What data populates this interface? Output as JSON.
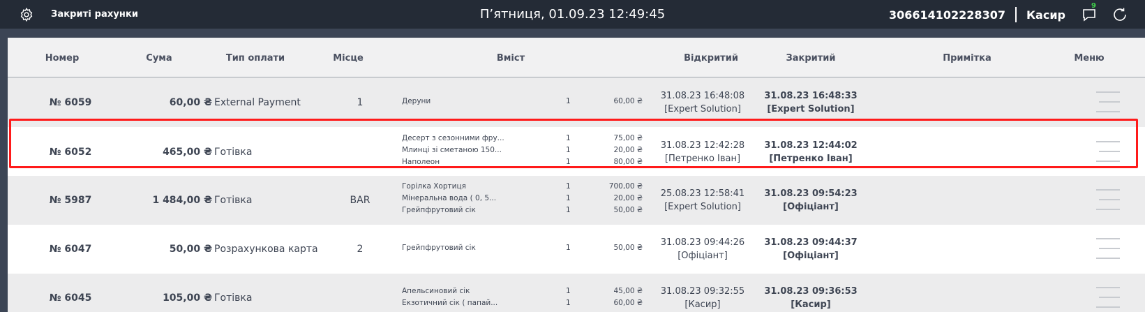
{
  "topbar": {
    "title": "Закриті рахунки",
    "datetime": "П’ятниця, 01.09.23 12:49:45",
    "code": "306614102228307",
    "role": "Касир",
    "chat_badge": "9"
  },
  "table": {
    "headers": {
      "number": "Номер",
      "sum": "Сума",
      "payment": "Тип оплати",
      "place": "Місце",
      "content": "Вміст",
      "opened": "Відкритий",
      "closed": "Закритий",
      "note": "Примітка",
      "menu": "Меню"
    },
    "rows": [
      {
        "number": "№ 6059",
        "sum": "60,00 ₴",
        "payment": "External Payment",
        "place": "1",
        "items": [
          {
            "name": "Деруни",
            "qty": "1",
            "price": "60,00 ₴"
          }
        ],
        "opened_time": "31.08.23 16:48:08",
        "opened_by": "[Expert Solution]",
        "closed_time": "31.08.23 16:48:33",
        "closed_by": "[Expert Solution]"
      },
      {
        "number": "№ 6052",
        "sum": "465,00 ₴",
        "payment": "Готівка",
        "place": "",
        "items": [
          {
            "name": "Десерт з сезонними фру...",
            "qty": "1",
            "price": "75,00 ₴"
          },
          {
            "name": "Млинці зі сметаною 150...",
            "qty": "1",
            "price": "20,00 ₴"
          },
          {
            "name": "Наполеон",
            "qty": "1",
            "price": "80,00 ₴"
          }
        ],
        "opened_time": "31.08.23 12:42:28",
        "opened_by": "[Петренко Іван]",
        "closed_time": "31.08.23 12:44:02",
        "closed_by": "[Петренко Іван]"
      },
      {
        "number": "№ 5987",
        "sum": "1 484,00 ₴",
        "payment": "Готівка",
        "place": "BAR",
        "items": [
          {
            "name": "Горілка Хортиця",
            "qty": "1",
            "price": "700,00 ₴"
          },
          {
            "name": "Мінеральна вода ( 0, 5...",
            "qty": "1",
            "price": "20,00 ₴"
          },
          {
            "name": "Грейпфрутовий сік",
            "qty": "1",
            "price": "50,00 ₴"
          }
        ],
        "opened_time": "25.08.23 12:58:41",
        "opened_by": "[Expert Solution]",
        "closed_time": "31.08.23 09:54:23",
        "closed_by": "[Офіціант]"
      },
      {
        "number": "№ 6047",
        "sum": "50,00 ₴",
        "payment": "Розрахункова карта",
        "place": "2",
        "items": [
          {
            "name": "Грейпфрутовий сік",
            "qty": "1",
            "price": "50,00 ₴"
          }
        ],
        "opened_time": "31.08.23 09:44:26",
        "opened_by": "[Офіціант]",
        "closed_time": "31.08.23 09:44:37",
        "closed_by": "[Офіціант]"
      },
      {
        "number": "№ 6045",
        "sum": "105,00 ₴",
        "payment": "Готівка",
        "place": "",
        "items": [
          {
            "name": "Апельсиновий сік",
            "qty": "1",
            "price": "45,00 ₴"
          },
          {
            "name": "Екзотичний сік ( папай...",
            "qty": "1",
            "price": "60,00 ₴"
          }
        ],
        "opened_time": "31.08.23 09:32:55",
        "opened_by": "[Касир]",
        "closed_time": "31.08.23 09:36:53",
        "closed_by": "[Касир]"
      }
    ]
  },
  "colors": {
    "topbar_bg": "#242b36",
    "page_bg": "#3c4555",
    "highlight": "#ff1a1a",
    "badge": "#3fd14a"
  }
}
